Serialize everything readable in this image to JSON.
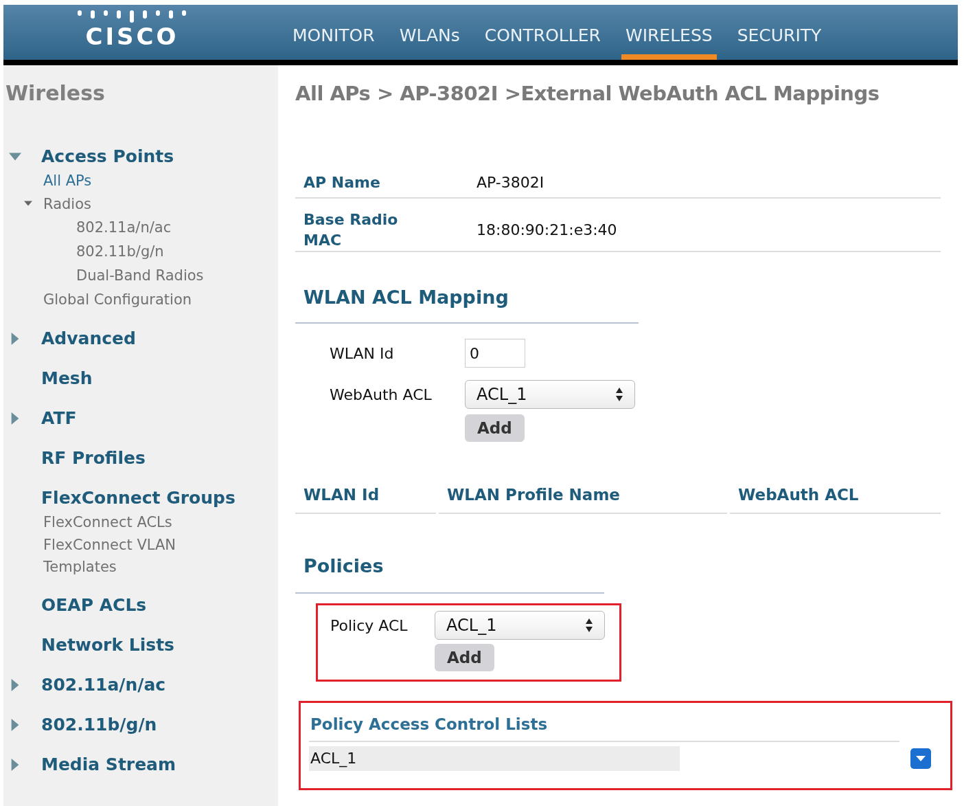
{
  "header": {
    "logo": "CISCO",
    "tabs": [
      {
        "label": "MONITOR",
        "selected": false
      },
      {
        "label": "WLANs",
        "selected": false
      },
      {
        "label": "CONTROLLER",
        "selected": false
      },
      {
        "label": "WIRELESS",
        "selected": true
      },
      {
        "label": "SECURITY",
        "selected": false
      }
    ]
  },
  "sidebar": {
    "title": "Wireless",
    "items": [
      {
        "label": "Access Points",
        "expanded": true,
        "children": [
          {
            "label": "All APs",
            "selected": true
          },
          {
            "label": "Radios",
            "selected": false,
            "expanded": true,
            "children": [
              {
                "label": "802.11a/n/ac",
                "selected": false
              },
              {
                "label": "802.11b/g/n",
                "selected": false
              },
              {
                "label": "Dual-Band Radios",
                "selected": false
              }
            ]
          },
          {
            "label": "Global Configuration",
            "selected": false
          }
        ]
      },
      {
        "label": "Advanced",
        "expanded": false
      },
      {
        "label": "Mesh"
      },
      {
        "label": "ATF",
        "expanded": false
      },
      {
        "label": "RF Profiles"
      },
      {
        "label": "FlexConnect Groups",
        "children": [
          {
            "label": "FlexConnect ACLs",
            "selected": false
          },
          {
            "label": "FlexConnect VLAN Templates",
            "selected": false
          }
        ]
      },
      {
        "label": "OEAP ACLs"
      },
      {
        "label": "Network Lists"
      },
      {
        "label": "802.11a/n/ac",
        "expanded": false
      },
      {
        "label": "802.11b/g/n",
        "expanded": false
      },
      {
        "label": "Media Stream",
        "expanded": false
      }
    ]
  },
  "main": {
    "breadcrumb": "All APs > AP-3802I >External WebAuth ACL Mappings",
    "details": [
      {
        "label": "AP Name",
        "value": "AP-3802I"
      },
      {
        "label": "Base Radio MAC",
        "value": "18:80:90:21:e3:40"
      }
    ],
    "wlan_mapping": {
      "title": "WLAN ACL Mapping",
      "wlan_id_label": "WLAN Id",
      "wlan_id_value": "0",
      "acl_label": "WebAuth ACL",
      "acl_value": "ACL_1",
      "add_button": "Add",
      "columns": [
        "WLAN Id",
        "WLAN Profile Name",
        "WebAuth ACL"
      ]
    },
    "policies": {
      "title": "Policies",
      "acl_label": "Policy ACL",
      "acl_value": "ACL_1",
      "add_button": "Add",
      "list_title": "Policy Access Control Lists",
      "rows": [
        {
          "name": "ACL_1"
        }
      ]
    }
  }
}
